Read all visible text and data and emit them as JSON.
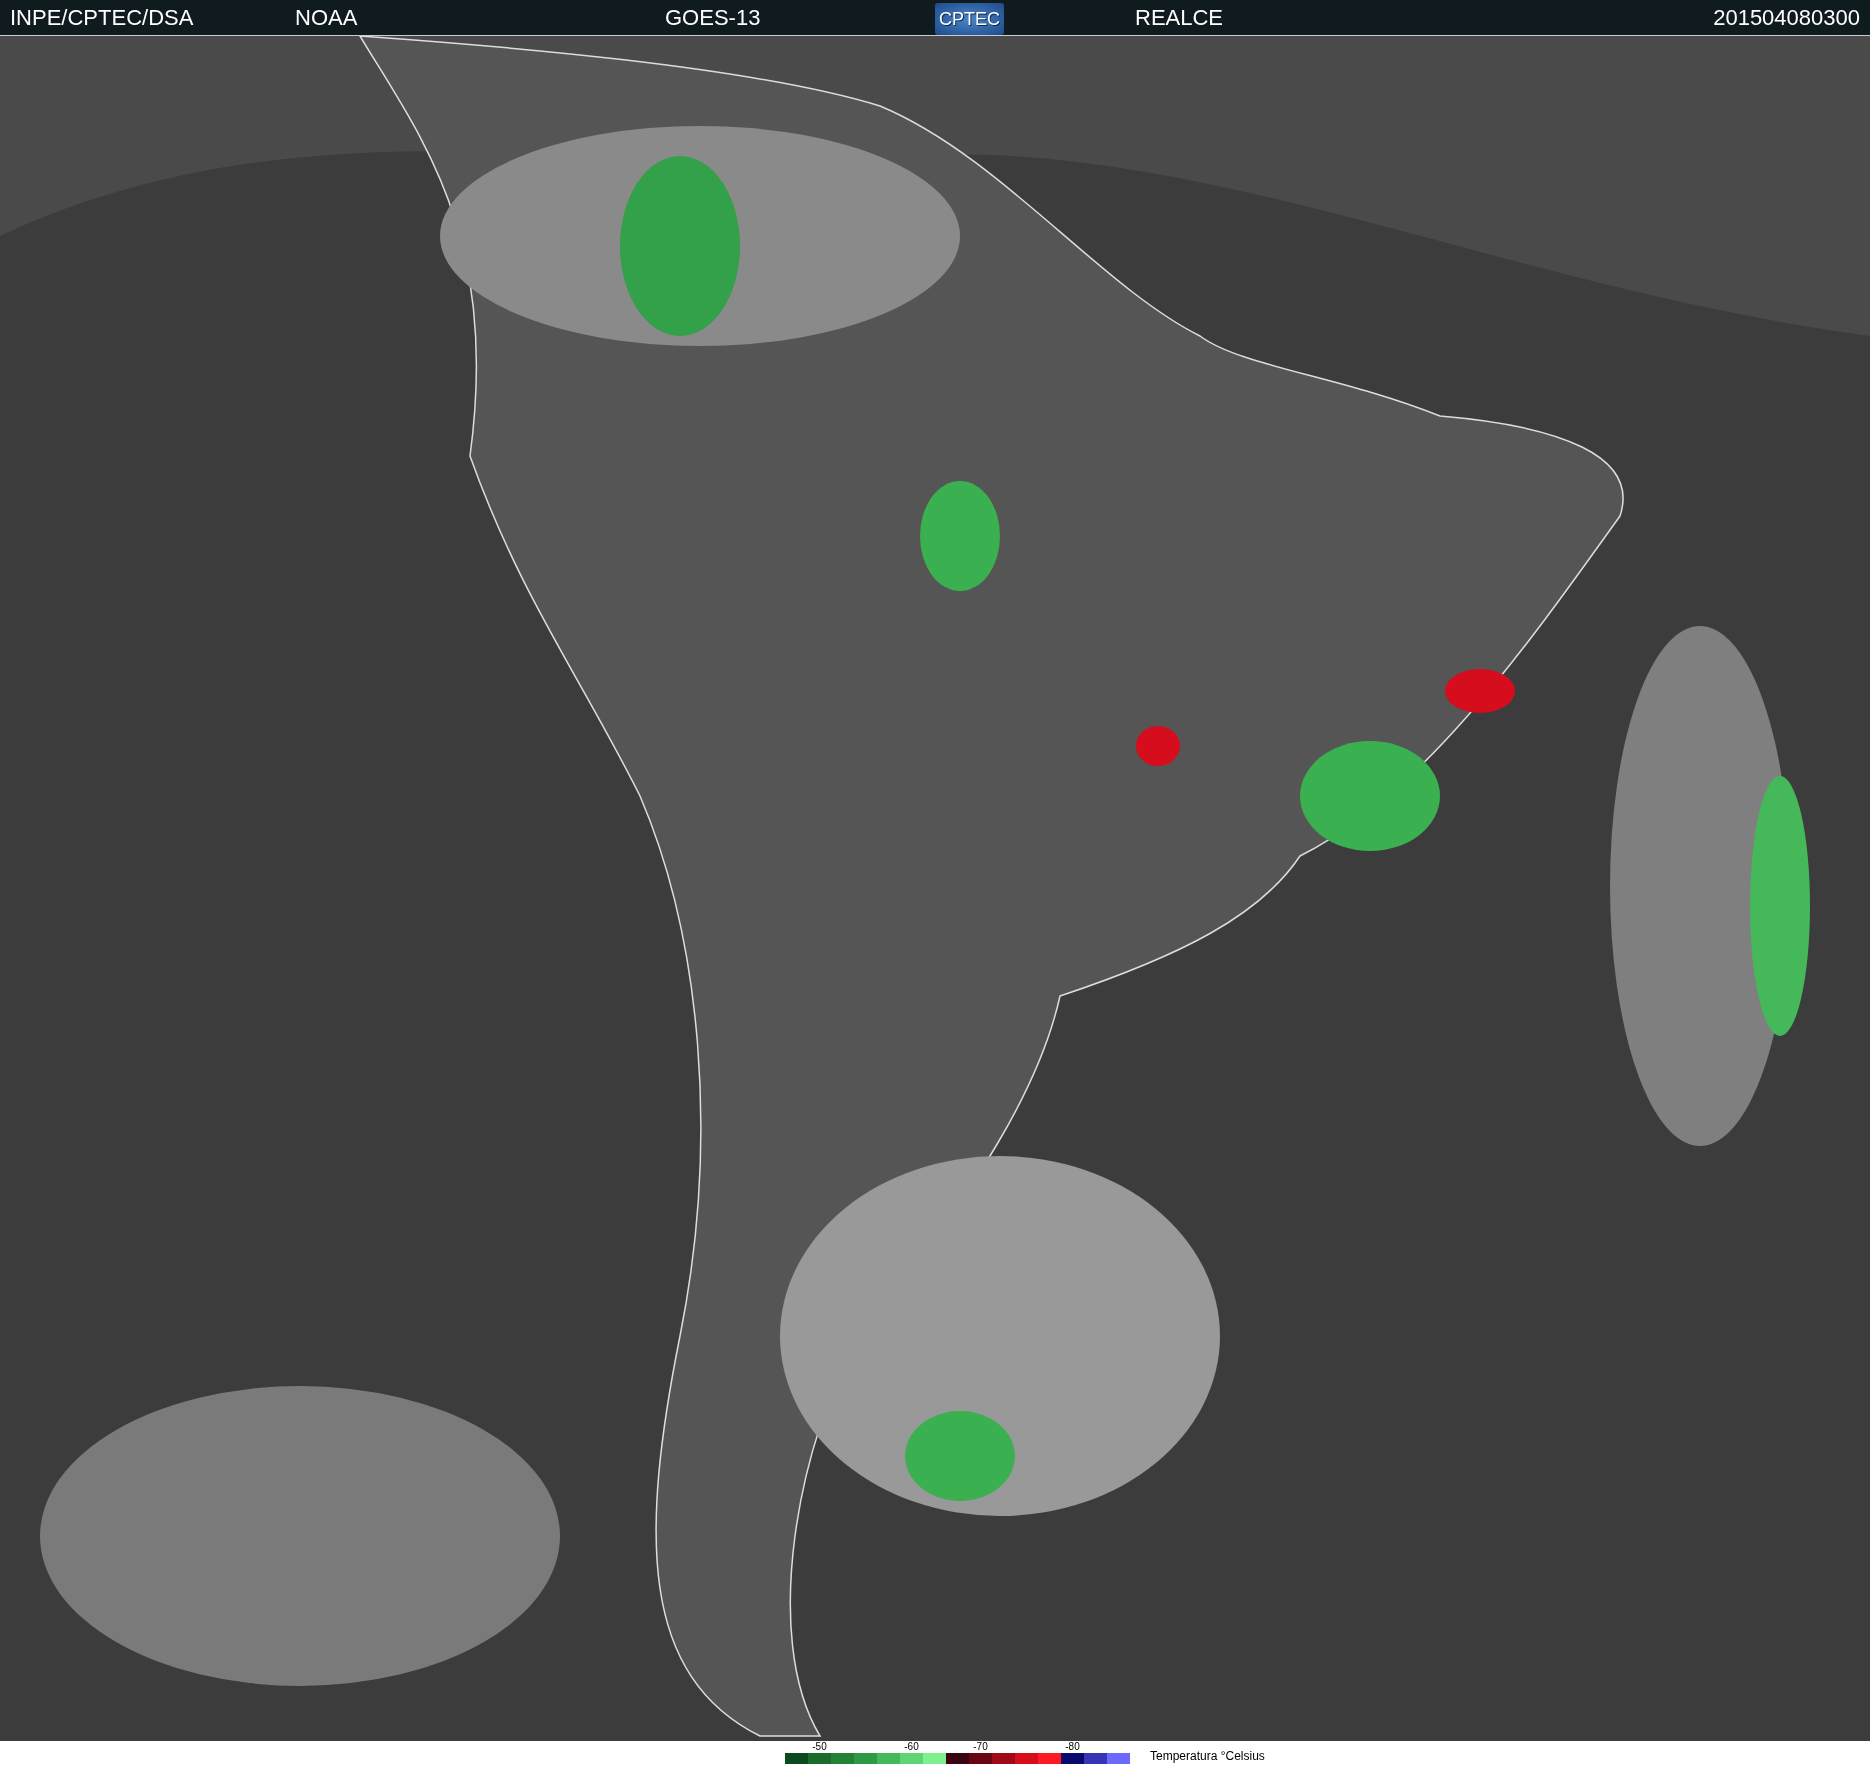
{
  "header": {
    "items": [
      {
        "kind": "text",
        "text": "INPE/CPTEC/DSA"
      },
      {
        "kind": "text",
        "text": "NOAA"
      },
      {
        "kind": "text",
        "text": "GOES-13"
      },
      {
        "kind": "logo",
        "text": "CPTEC"
      },
      {
        "kind": "text",
        "text": "REALCE"
      },
      {
        "kind": "text",
        "text": "201504080300"
      }
    ]
  },
  "legend": {
    "title": "Temperatura °Celsius",
    "swatches": [
      {
        "color": "#0b4a1c"
      },
      {
        "color": "#1a6b2c",
        "label": "-50"
      },
      {
        "color": "#248236"
      },
      {
        "color": "#2f9a45"
      },
      {
        "color": "#45b85a"
      },
      {
        "color": "#5fd473",
        "label": "-60"
      },
      {
        "color": "#7ff08e"
      },
      {
        "color": "#3a0510"
      },
      {
        "color": "#6a0612",
        "label": "-70"
      },
      {
        "color": "#a00a18"
      },
      {
        "color": "#d50d1c"
      },
      {
        "color": "#ff1a22"
      },
      {
        "color": "#0a0a6e",
        "label": "-80"
      },
      {
        "color": "#3535b5"
      },
      {
        "color": "#6a6aff"
      }
    ]
  }
}
